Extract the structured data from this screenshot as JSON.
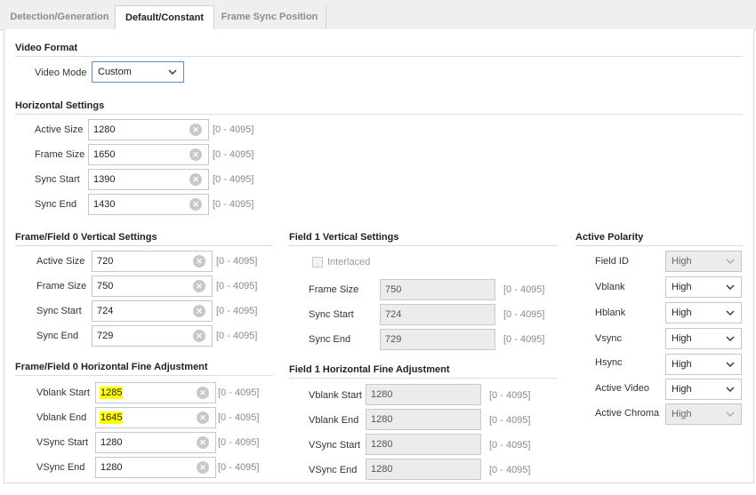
{
  "tabs": [
    {
      "label": "Detection/Generation"
    },
    {
      "label": "Default/Constant"
    },
    {
      "label": "Frame Sync Position"
    }
  ],
  "active_tab": "Default/Constant",
  "video_format": {
    "title": "Video Format",
    "video_mode_label": "Video Mode",
    "video_mode_value": "Custom"
  },
  "horizontal": {
    "title": "Horizontal Settings",
    "fields": [
      {
        "label": "Active Size",
        "value": "1280",
        "range": "[0 - 4095]"
      },
      {
        "label": "Frame Size",
        "value": "1650",
        "range": "[0 - 4095]"
      },
      {
        "label": "Sync Start",
        "value": "1390",
        "range": "[0 - 4095]"
      },
      {
        "label": "Sync End",
        "value": "1430",
        "range": "[0 - 4095]"
      }
    ]
  },
  "field0_vertical": {
    "title": "Frame/Field 0 Vertical Settings",
    "fields": [
      {
        "label": "Active Size",
        "value": "720",
        "range": "[0 - 4095]"
      },
      {
        "label": "Frame Size",
        "value": "750",
        "range": "[0 - 4095]"
      },
      {
        "label": "Sync Start",
        "value": "724",
        "range": "[0 - 4095]"
      },
      {
        "label": "Sync End",
        "value": "729",
        "range": "[0 - 4095]"
      }
    ]
  },
  "field0_fine": {
    "title": "Frame/Field 0 Horizontal Fine Adjustment",
    "fields": [
      {
        "label": "Vblank Start",
        "value": "1285",
        "range": "[0 - 4095]"
      },
      {
        "label": "Vblank End",
        "value": "1645",
        "range": "[0 - 4095]"
      },
      {
        "label": "VSync Start",
        "value": "1280",
        "range": "[0 - 4095]"
      },
      {
        "label": "VSync End",
        "value": "1280",
        "range": "[0 - 4095]"
      }
    ]
  },
  "field1_vertical": {
    "title": "Field 1 Vertical Settings",
    "interlaced_label": "Interlaced",
    "fields": [
      {
        "label": "Frame Size",
        "value": "750",
        "range": "[0 - 4095]"
      },
      {
        "label": "Sync Start",
        "value": "724",
        "range": "[0 - 4095]"
      },
      {
        "label": "Sync End",
        "value": "729",
        "range": "[0 - 4095]"
      }
    ]
  },
  "field1_fine": {
    "title": "Field 1 Horizontal Fine Adjustment",
    "fields": [
      {
        "label": "Vblank Start",
        "value": "1280",
        "range": "[0 - 4095]"
      },
      {
        "label": "Vblank End",
        "value": "1280",
        "range": "[0 - 4095]"
      },
      {
        "label": "VSync Start",
        "value": "1280",
        "range": "[0 - 4095]"
      },
      {
        "label": "VSync End",
        "value": "1280",
        "range": "[0 - 4095]"
      }
    ]
  },
  "polarity": {
    "title": "Active Polarity",
    "items": [
      {
        "label": "Field ID",
        "value": "High"
      },
      {
        "label": "Vblank",
        "value": "High"
      },
      {
        "label": "Hblank",
        "value": "High"
      },
      {
        "label": "Vsync",
        "value": "High"
      },
      {
        "label": "Hsync",
        "value": "High"
      },
      {
        "label": "Active Video",
        "value": "High"
      },
      {
        "label": "Active Chroma",
        "value": "High"
      }
    ]
  },
  "colors": {
    "highlight": "#ffff00",
    "focus_border": "#5a8fd0",
    "tab_bar": "#efefef"
  }
}
